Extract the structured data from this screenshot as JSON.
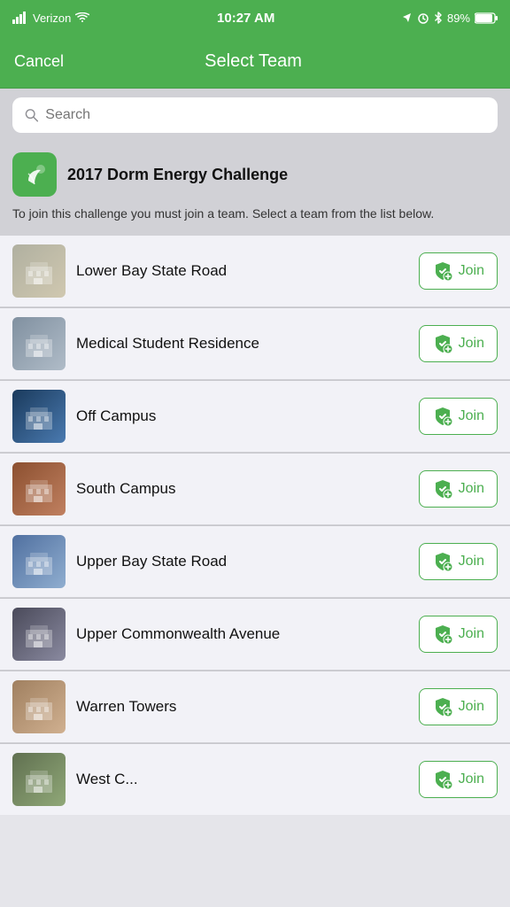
{
  "statusBar": {
    "carrier": "Verizon",
    "time": "10:27 AM",
    "battery": "89%"
  },
  "navBar": {
    "cancelLabel": "Cancel",
    "title": "Select Team"
  },
  "search": {
    "placeholder": "Search"
  },
  "challenge": {
    "title": "2017 Dorm Energy Challenge",
    "description": "To join this challenge you must join a team. Select a team from the list below."
  },
  "teams": [
    {
      "id": "lower-bay",
      "name": "Lower Bay State Road",
      "photoClass": "photo-lower"
    },
    {
      "id": "medical",
      "name": "Medical Student Residence",
      "photoClass": "photo-medical"
    },
    {
      "id": "off-campus",
      "name": "Off Campus",
      "photoClass": "photo-offcampus"
    },
    {
      "id": "south-campus",
      "name": "South Campus",
      "photoClass": "photo-south"
    },
    {
      "id": "upper-bay",
      "name": "Upper Bay State Road",
      "photoClass": "photo-upper-bay"
    },
    {
      "id": "upper-common",
      "name": "Upper Commonwealth Avenue",
      "photoClass": "photo-upper-common"
    },
    {
      "id": "warren",
      "name": "Warren Towers",
      "photoClass": "photo-warren"
    },
    {
      "id": "west",
      "name": "West C...",
      "photoClass": "photo-west"
    }
  ],
  "joinLabel": "Join"
}
